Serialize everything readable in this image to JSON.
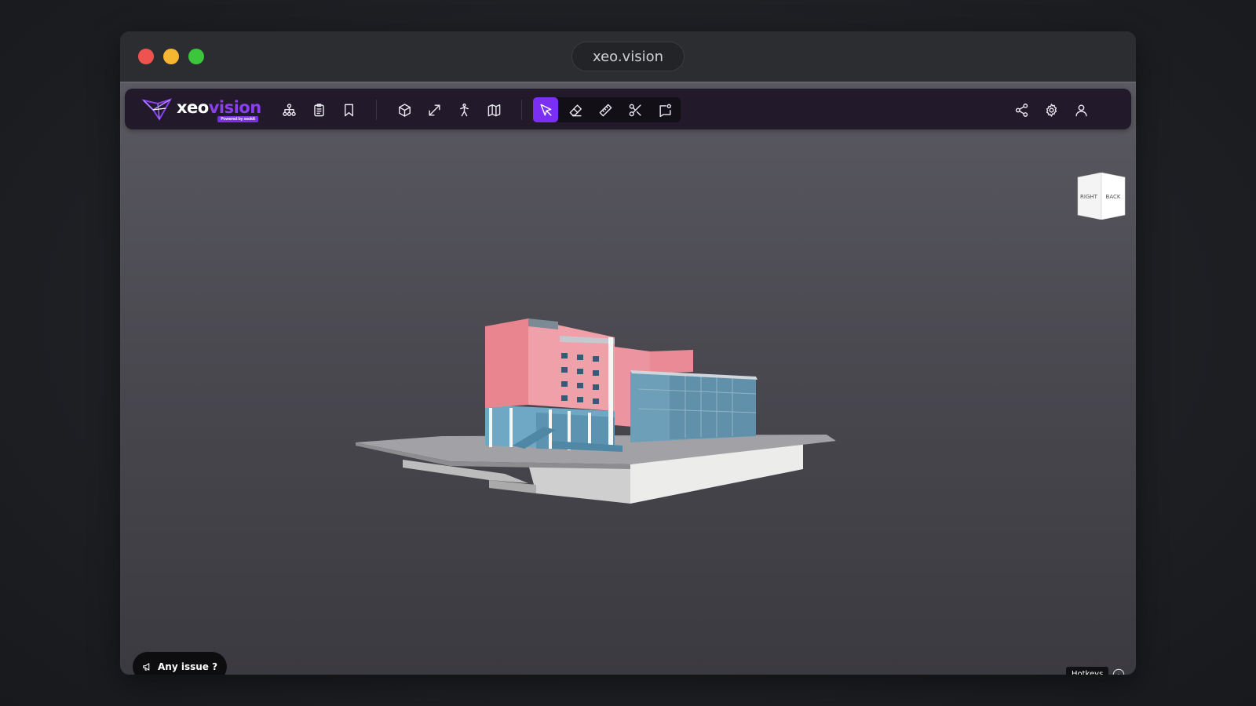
{
  "window": {
    "url": "xeo.vision"
  },
  "toolbar": {
    "logo": {
      "prefix": "xeo",
      "suffix": "vision",
      "tagline": "Powered by xeokit"
    },
    "left_tools": [
      {
        "name": "tree-view",
        "icon": "hierarchy-icon"
      },
      {
        "name": "properties",
        "icon": "clipboard-icon"
      },
      {
        "name": "bookmarks",
        "icon": "bookmark-icon"
      }
    ],
    "view_tools": [
      {
        "name": "3d-view",
        "icon": "cube-icon"
      },
      {
        "name": "fit-view",
        "icon": "expand-arrow-icon"
      },
      {
        "name": "first-person",
        "icon": "walk-person-icon"
      },
      {
        "name": "plan-view",
        "icon": "map-icon"
      }
    ],
    "interaction_tools": [
      {
        "name": "select",
        "icon": "cursor-arrow-icon",
        "active": true
      },
      {
        "name": "eraser",
        "icon": "eraser-icon",
        "active": false
      },
      {
        "name": "measure",
        "icon": "ruler-icon",
        "active": false
      },
      {
        "name": "section",
        "icon": "scissors-icon",
        "active": false
      },
      {
        "name": "annotate",
        "icon": "comment-flag-icon",
        "active": false
      }
    ],
    "right_tools": [
      {
        "name": "share",
        "icon": "share-icon"
      },
      {
        "name": "settings",
        "icon": "gear-icon"
      },
      {
        "name": "account",
        "icon": "user-icon"
      }
    ],
    "accent_color": "#7b2ff2"
  },
  "navcube": {
    "left_face": "RIGHT",
    "right_face": "BACK"
  },
  "footer": {
    "issue_label": "Any issue ?",
    "hotkeys_label": "Hotkeys"
  }
}
